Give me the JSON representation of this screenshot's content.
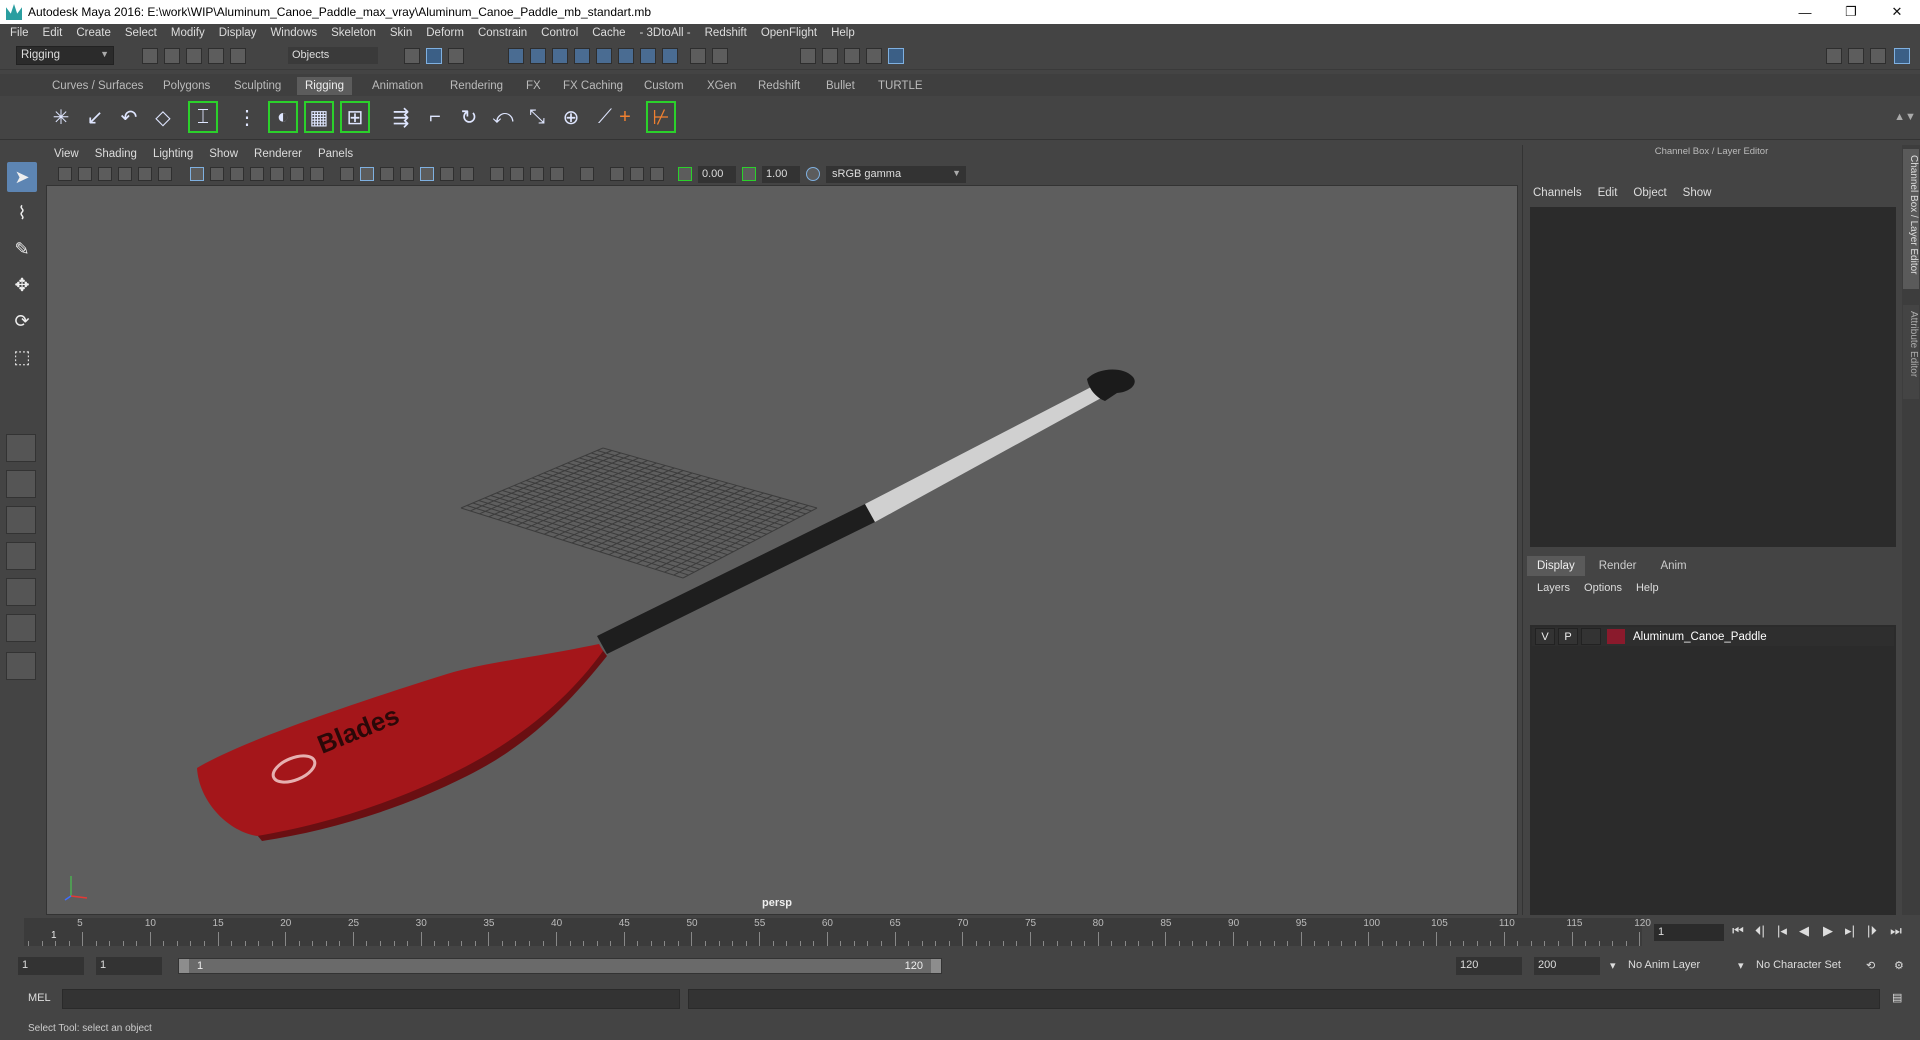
{
  "window": {
    "title": "Autodesk Maya 2016: E:\\work\\WIP\\Aluminum_Canoe_Paddle_max_vray\\Aluminum_Canoe_Paddle_mb_standart.mb",
    "minimize": "—",
    "restore": "❐",
    "close": "✕"
  },
  "menubar": [
    "File",
    "Edit",
    "Create",
    "Select",
    "Modify",
    "Display",
    "Windows",
    "Skeleton",
    "Skin",
    "Deform",
    "Constrain",
    "Control",
    "Cache",
    "- 3DtoAll -",
    "Redshift",
    "OpenFlight",
    "Help"
  ],
  "statusline": {
    "mode": "Rigging",
    "selection_mask": "Objects"
  },
  "shelf": {
    "tabs": [
      "Curves / Surfaces",
      "Polygons",
      "Sculpting",
      "Rigging",
      "Animation",
      "Rendering",
      "FX",
      "FX Caching",
      "Custom",
      "XGen",
      "Redshift",
      "Bullet",
      "TURTLE"
    ],
    "active_tab": "Rigging",
    "icons": [
      "joint-tool-icon",
      "ik-handle-icon",
      "ik-spline-icon",
      "insert-joint-icon",
      "mirror-joint-icon",
      "bind-skin-icon",
      "paint-weights-icon",
      "lattice-icon",
      "cluster-icon",
      "orient-joint-icon",
      "parent-constraint-icon",
      "point-constraint-icon",
      "orient-constraint-icon",
      "scale-constraint-icon",
      "aim-constraint-icon",
      "pole-vector-icon",
      "locator-icon",
      "hik-icon"
    ]
  },
  "viewport": {
    "menu": [
      "View",
      "Shading",
      "Lighting",
      "Show",
      "Renderer",
      "Panels"
    ],
    "exposure": "0.00",
    "gamma": "1.00",
    "color_space": "sRGB gamma",
    "camera": "persp"
  },
  "channel_box": {
    "header": "Channel Box / Layer Editor",
    "menu": [
      "Channels",
      "Edit",
      "Object",
      "Show"
    ]
  },
  "layer_editor": {
    "tabs": [
      "Display",
      "Render",
      "Anim"
    ],
    "active_tab": "Display",
    "menu": [
      "Layers",
      "Options",
      "Help"
    ],
    "layers": [
      {
        "visible": "V",
        "playback": "P",
        "name": "Aluminum_Canoe_Paddle",
        "color": "#8a1a2c"
      }
    ]
  },
  "side_tabs": [
    "Channel Box / Layer Editor",
    "Attribute Editor"
  ],
  "timeline": {
    "ticks": [
      "5",
      "10",
      "15",
      "20",
      "25",
      "30",
      "35",
      "40",
      "45",
      "50",
      "55",
      "60",
      "65",
      "70",
      "75",
      "80",
      "85",
      "90",
      "95",
      "100",
      "105",
      "110",
      "115",
      "120"
    ],
    "current_frame_label": "1",
    "current_frame_field": "1",
    "playback_buttons": [
      "⏮",
      "⏴|",
      "|◂",
      "◀",
      "▶",
      "▸|",
      "|⏵",
      "⏭"
    ]
  },
  "range": {
    "start": "1",
    "playback_start": "1",
    "slider_start": "1",
    "slider_end": "120",
    "playback_end": "120",
    "end": "200",
    "anim_layer": "No Anim Layer",
    "character_set": "No Character Set"
  },
  "command_line": {
    "label": "MEL",
    "help": "Select Tool: select an object"
  },
  "paddle": {
    "brand_text": "Blades",
    "blade_color": "#a4161a",
    "shaft_color": "#d0d0d0",
    "grip_color": "#1e1e1e"
  }
}
